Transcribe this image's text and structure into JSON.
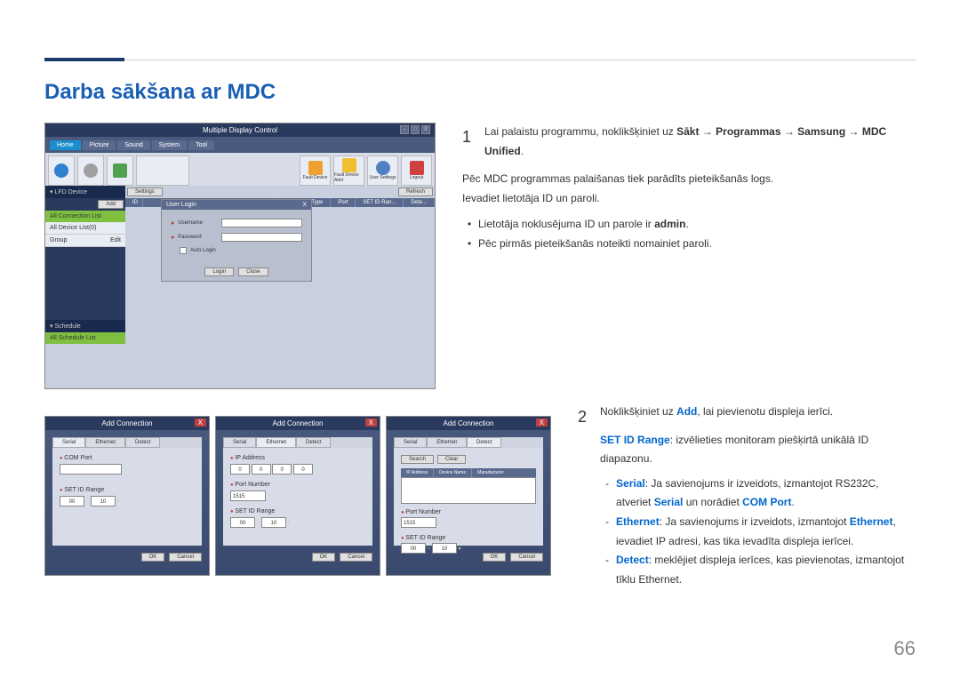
{
  "pageTitle": "Darba sākšana ar MDC",
  "pageNumber": "66",
  "mainScreenshot": {
    "windowTitle": "Multiple Display Control",
    "tabs": [
      "Home",
      "Picture",
      "Sound",
      "System",
      "Tool"
    ],
    "toolbarItems": [
      "Fault Device",
      "Fault Device Alert",
      "User Settings",
      "Logout"
    ],
    "sidebarLfd": "▾ LFD Device",
    "sidebarConnList": "All Connection List",
    "sidebarAllDevice": "All Device List(0)",
    "sidebarGroup": "Group",
    "sidebarEdit": "Edit",
    "sidebarAdd": "Add",
    "sidebarRefresh": "Refresh",
    "sidebarSchedule": "▾ Schedule",
    "sidebarAllSchedule": "All Schedule List",
    "panelSettings": "Settings",
    "tableHeaders": [
      "ID",
      "Connection Type",
      "Port",
      "SET ID Ran...",
      "Dete..."
    ],
    "loginTitle": "User Login",
    "loginClose": "X",
    "usernameLabel": "Username",
    "passwordLabel": "Password",
    "autoLoginLabel": "Auto Login",
    "loginBtn": "Login",
    "closeBtn": "Close"
  },
  "step1": {
    "num": "1",
    "line1a": "Lai palaistu programmu, noklikšķiniet uz ",
    "line1b": "Sākt → Programmas → Samsung → MDC Unified",
    "line2": "Pēc MDC programmas palaišanas tiek parādīts pieteikšanās logs.",
    "line3": "Ievadiet lietotāja ID un paroli.",
    "bullet1a": "Lietotāja noklusējuma ID un parole ir ",
    "bullet1b": "admin",
    "bullet2": "Pēc pirmās pieteikšanās noteikti nomainiet paroli."
  },
  "addConn": {
    "title": "Add Connection",
    "tabs": [
      "Serial",
      "Ethernet",
      "Detect"
    ],
    "comPort": "COM Port",
    "setIdRange": "SET ID Range",
    "ipAddress": "IP Address",
    "portNumber": "Port Number",
    "portValue": "1515",
    "deviceName": "Device Name",
    "manufacturer": "Manufacturer",
    "searchBtn": "Search",
    "clearBtn": "Clear",
    "okBtn": "OK",
    "cancelBtn": "Cancel",
    "rangeFrom": "00",
    "rangeTo": "10",
    "ipZero": "0"
  },
  "step2": {
    "num": "2",
    "line1a": "Noklikšķiniet uz ",
    "addLink": "Add",
    "line1b": ", lai pievienotu displeja ierīci.",
    "line2a": "SET ID Range",
    "line2b": ": izvēlieties monitoram piešķirtā unikālā ID diapazonu.",
    "serial": "Serial",
    "serialText1": ": Ja savienojums ir izveidots, izmantojot RS232C, atveriet ",
    "serialLink": "Serial",
    "serialText2": " un norādiet ",
    "comPortLink": "COM Port",
    "ethernet": "Ethernet",
    "ethernetText1": ": Ja savienojums ir izveidots, izmantojot ",
    "ethernetLink": "Ethernet",
    "ethernetText2": ", ievadiet IP adresi, kas tika ievadīta displeja ierīcei.",
    "detect": "Detect",
    "detectText": ": meklējiet displeja ierīces, kas pievienotas, izmantojot tīklu Ethernet."
  }
}
